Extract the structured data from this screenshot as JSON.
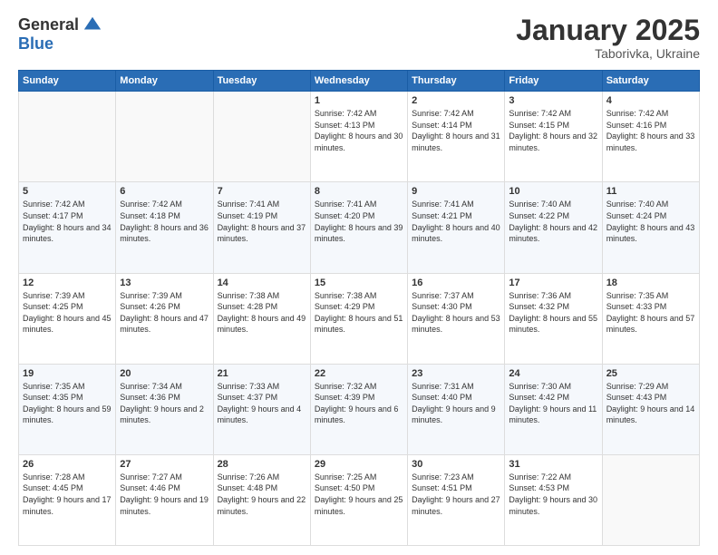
{
  "header": {
    "logo_general": "General",
    "logo_blue": "Blue",
    "month_title": "January 2025",
    "subtitle": "Taborivka, Ukraine"
  },
  "days_of_week": [
    "Sunday",
    "Monday",
    "Tuesday",
    "Wednesday",
    "Thursday",
    "Friday",
    "Saturday"
  ],
  "weeks": [
    [
      {
        "day": "",
        "info": ""
      },
      {
        "day": "",
        "info": ""
      },
      {
        "day": "",
        "info": ""
      },
      {
        "day": "1",
        "info": "Sunrise: 7:42 AM\nSunset: 4:13 PM\nDaylight: 8 hours\nand 30 minutes."
      },
      {
        "day": "2",
        "info": "Sunrise: 7:42 AM\nSunset: 4:14 PM\nDaylight: 8 hours\nand 31 minutes."
      },
      {
        "day": "3",
        "info": "Sunrise: 7:42 AM\nSunset: 4:15 PM\nDaylight: 8 hours\nand 32 minutes."
      },
      {
        "day": "4",
        "info": "Sunrise: 7:42 AM\nSunset: 4:16 PM\nDaylight: 8 hours\nand 33 minutes."
      }
    ],
    [
      {
        "day": "5",
        "info": "Sunrise: 7:42 AM\nSunset: 4:17 PM\nDaylight: 8 hours\nand 34 minutes."
      },
      {
        "day": "6",
        "info": "Sunrise: 7:42 AM\nSunset: 4:18 PM\nDaylight: 8 hours\nand 36 minutes."
      },
      {
        "day": "7",
        "info": "Sunrise: 7:41 AM\nSunset: 4:19 PM\nDaylight: 8 hours\nand 37 minutes."
      },
      {
        "day": "8",
        "info": "Sunrise: 7:41 AM\nSunset: 4:20 PM\nDaylight: 8 hours\nand 39 minutes."
      },
      {
        "day": "9",
        "info": "Sunrise: 7:41 AM\nSunset: 4:21 PM\nDaylight: 8 hours\nand 40 minutes."
      },
      {
        "day": "10",
        "info": "Sunrise: 7:40 AM\nSunset: 4:22 PM\nDaylight: 8 hours\nand 42 minutes."
      },
      {
        "day": "11",
        "info": "Sunrise: 7:40 AM\nSunset: 4:24 PM\nDaylight: 8 hours\nand 43 minutes."
      }
    ],
    [
      {
        "day": "12",
        "info": "Sunrise: 7:39 AM\nSunset: 4:25 PM\nDaylight: 8 hours\nand 45 minutes."
      },
      {
        "day": "13",
        "info": "Sunrise: 7:39 AM\nSunset: 4:26 PM\nDaylight: 8 hours\nand 47 minutes."
      },
      {
        "day": "14",
        "info": "Sunrise: 7:38 AM\nSunset: 4:28 PM\nDaylight: 8 hours\nand 49 minutes."
      },
      {
        "day": "15",
        "info": "Sunrise: 7:38 AM\nSunset: 4:29 PM\nDaylight: 8 hours\nand 51 minutes."
      },
      {
        "day": "16",
        "info": "Sunrise: 7:37 AM\nSunset: 4:30 PM\nDaylight: 8 hours\nand 53 minutes."
      },
      {
        "day": "17",
        "info": "Sunrise: 7:36 AM\nSunset: 4:32 PM\nDaylight: 8 hours\nand 55 minutes."
      },
      {
        "day": "18",
        "info": "Sunrise: 7:35 AM\nSunset: 4:33 PM\nDaylight: 8 hours\nand 57 minutes."
      }
    ],
    [
      {
        "day": "19",
        "info": "Sunrise: 7:35 AM\nSunset: 4:35 PM\nDaylight: 8 hours\nand 59 minutes."
      },
      {
        "day": "20",
        "info": "Sunrise: 7:34 AM\nSunset: 4:36 PM\nDaylight: 9 hours\nand 2 minutes."
      },
      {
        "day": "21",
        "info": "Sunrise: 7:33 AM\nSunset: 4:37 PM\nDaylight: 9 hours\nand 4 minutes."
      },
      {
        "day": "22",
        "info": "Sunrise: 7:32 AM\nSunset: 4:39 PM\nDaylight: 9 hours\nand 6 minutes."
      },
      {
        "day": "23",
        "info": "Sunrise: 7:31 AM\nSunset: 4:40 PM\nDaylight: 9 hours\nand 9 minutes."
      },
      {
        "day": "24",
        "info": "Sunrise: 7:30 AM\nSunset: 4:42 PM\nDaylight: 9 hours\nand 11 minutes."
      },
      {
        "day": "25",
        "info": "Sunrise: 7:29 AM\nSunset: 4:43 PM\nDaylight: 9 hours\nand 14 minutes."
      }
    ],
    [
      {
        "day": "26",
        "info": "Sunrise: 7:28 AM\nSunset: 4:45 PM\nDaylight: 9 hours\nand 17 minutes."
      },
      {
        "day": "27",
        "info": "Sunrise: 7:27 AM\nSunset: 4:46 PM\nDaylight: 9 hours\nand 19 minutes."
      },
      {
        "day": "28",
        "info": "Sunrise: 7:26 AM\nSunset: 4:48 PM\nDaylight: 9 hours\nand 22 minutes."
      },
      {
        "day": "29",
        "info": "Sunrise: 7:25 AM\nSunset: 4:50 PM\nDaylight: 9 hours\nand 25 minutes."
      },
      {
        "day": "30",
        "info": "Sunrise: 7:23 AM\nSunset: 4:51 PM\nDaylight: 9 hours\nand 27 minutes."
      },
      {
        "day": "31",
        "info": "Sunrise: 7:22 AM\nSunset: 4:53 PM\nDaylight: 9 hours\nand 30 minutes."
      },
      {
        "day": "",
        "info": ""
      }
    ]
  ]
}
